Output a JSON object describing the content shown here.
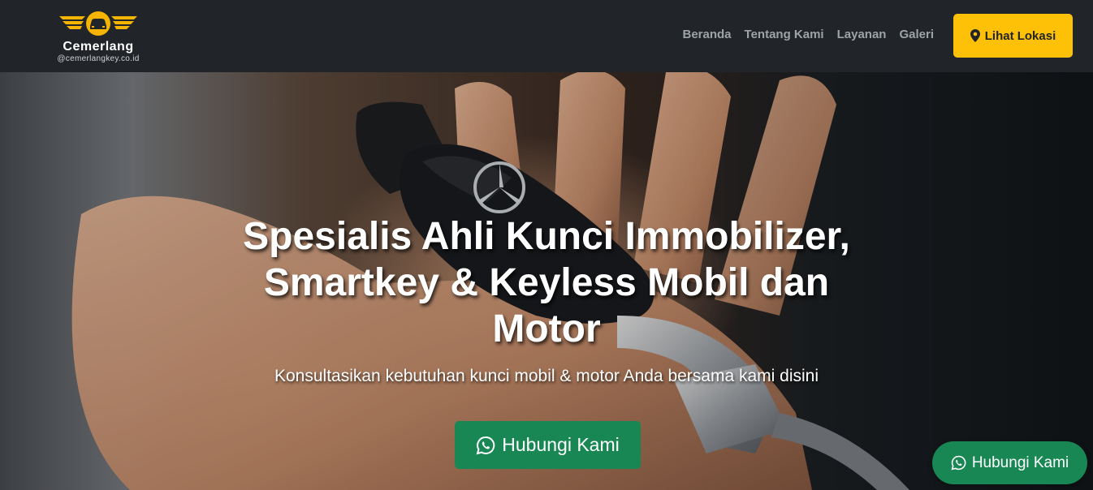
{
  "brand": {
    "name": "Cemerlang",
    "handle": "@cemerlangkey.co.id",
    "logo_icon": "car-wings-logo",
    "accent_color": "#f5b400"
  },
  "nav": {
    "items": [
      {
        "label": "Beranda"
      },
      {
        "label": "Tentang Kami"
      },
      {
        "label": "Layanan"
      },
      {
        "label": "Galeri"
      }
    ],
    "location_button": {
      "label": "Lihat Lokasi",
      "icon": "map-pin-icon",
      "color": "#ffc107"
    },
    "background": "#212529"
  },
  "hero": {
    "title": "Spesialis Ahli Kunci Immobilizer, Smartkey & Keyless Mobil dan Motor",
    "subtitle": "Konsultasikan kebutuhan kunci mobil & motor Anda bersama kami disini",
    "cta": {
      "label": "Hubungi Kami",
      "icon": "whatsapp-icon",
      "color": "#198754"
    }
  },
  "floating_cta": {
    "label": "Hubungi Kami",
    "icon": "whatsapp-icon",
    "color": "#198754"
  }
}
